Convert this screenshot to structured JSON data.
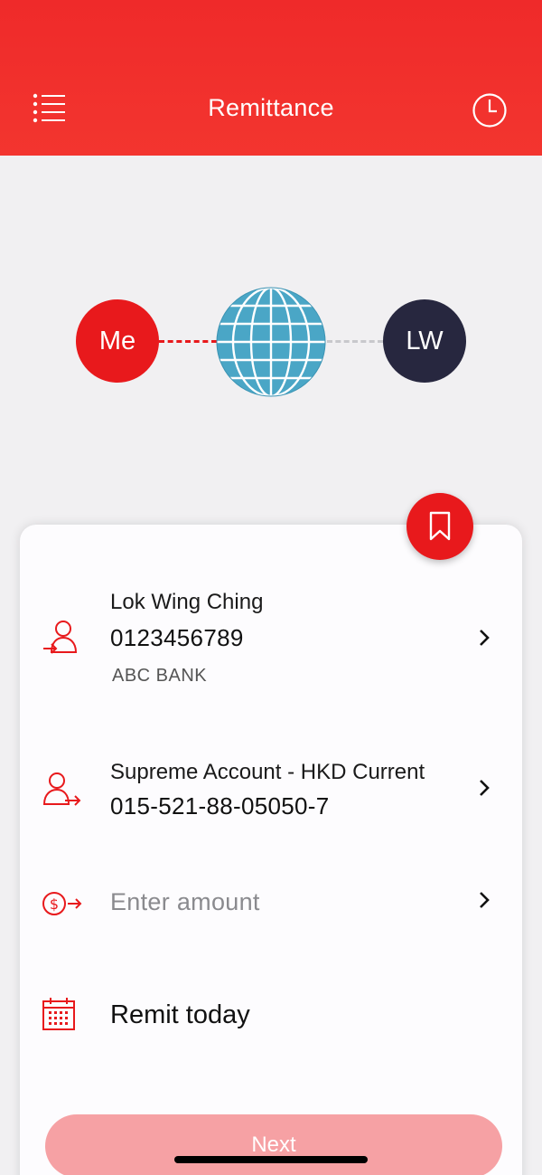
{
  "header": {
    "title": "Remittance",
    "menu_icon": "list-menu-icon",
    "history_icon": "clock-icon",
    "background": "#ef2a2a"
  },
  "flow": {
    "sender_initials": "Me",
    "receiver_initials": "LW",
    "sender_color": "#e8191c",
    "receiver_color": "#27273f",
    "globe_color": "#4aa6c6"
  },
  "payee": {
    "name": "Lok Wing Ching",
    "account_number": "0123456789",
    "bank": "ABC BANK"
  },
  "from_account": {
    "name": "Supreme Account - HKD Current",
    "account_number": "015-521-88-05050-7"
  },
  "amount": {
    "placeholder": "Enter amount"
  },
  "date": {
    "label": "Remit today"
  },
  "next_button": {
    "label": "Next"
  },
  "accent_color": "#e8191c"
}
